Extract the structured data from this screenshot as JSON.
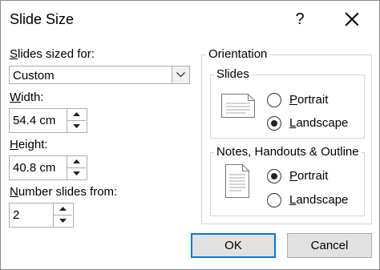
{
  "dialog": {
    "title": "Slide Size",
    "help": "?"
  },
  "slides_sized_for": {
    "label_ul": "S",
    "label_rest": "lides sized for:",
    "value": "Custom"
  },
  "width": {
    "label_ul": "W",
    "label_rest": "idth:",
    "value": "54.4 cm"
  },
  "height": {
    "label_ul": "H",
    "label_rest": "eight:",
    "value": "40.8 cm"
  },
  "number_from": {
    "label_ul": "N",
    "label_rest": "umber slides from:",
    "value": "2"
  },
  "orientation": {
    "legend": "Orientation",
    "slides": {
      "legend": "Slides",
      "portrait_ul": "P",
      "portrait_rest": "ortrait",
      "portrait_selected": false,
      "landscape_ul": "L",
      "landscape_rest": "andscape",
      "landscape_selected": true
    },
    "notes": {
      "legend": "Notes, Handouts & Outline",
      "portrait_ul": "P",
      "portrait_rest": "ortrait",
      "portrait_selected": true,
      "landscape_ul": "L",
      "landscape_rest": "andscape",
      "landscape_selected": false
    }
  },
  "buttons": {
    "ok": "OK",
    "cancel": "Cancel"
  },
  "icons": [
    "close-icon",
    "dropdown-arrow-icon",
    "spin-up-icon",
    "spin-down-icon",
    "landscape-page-icon",
    "portrait-page-icon"
  ]
}
